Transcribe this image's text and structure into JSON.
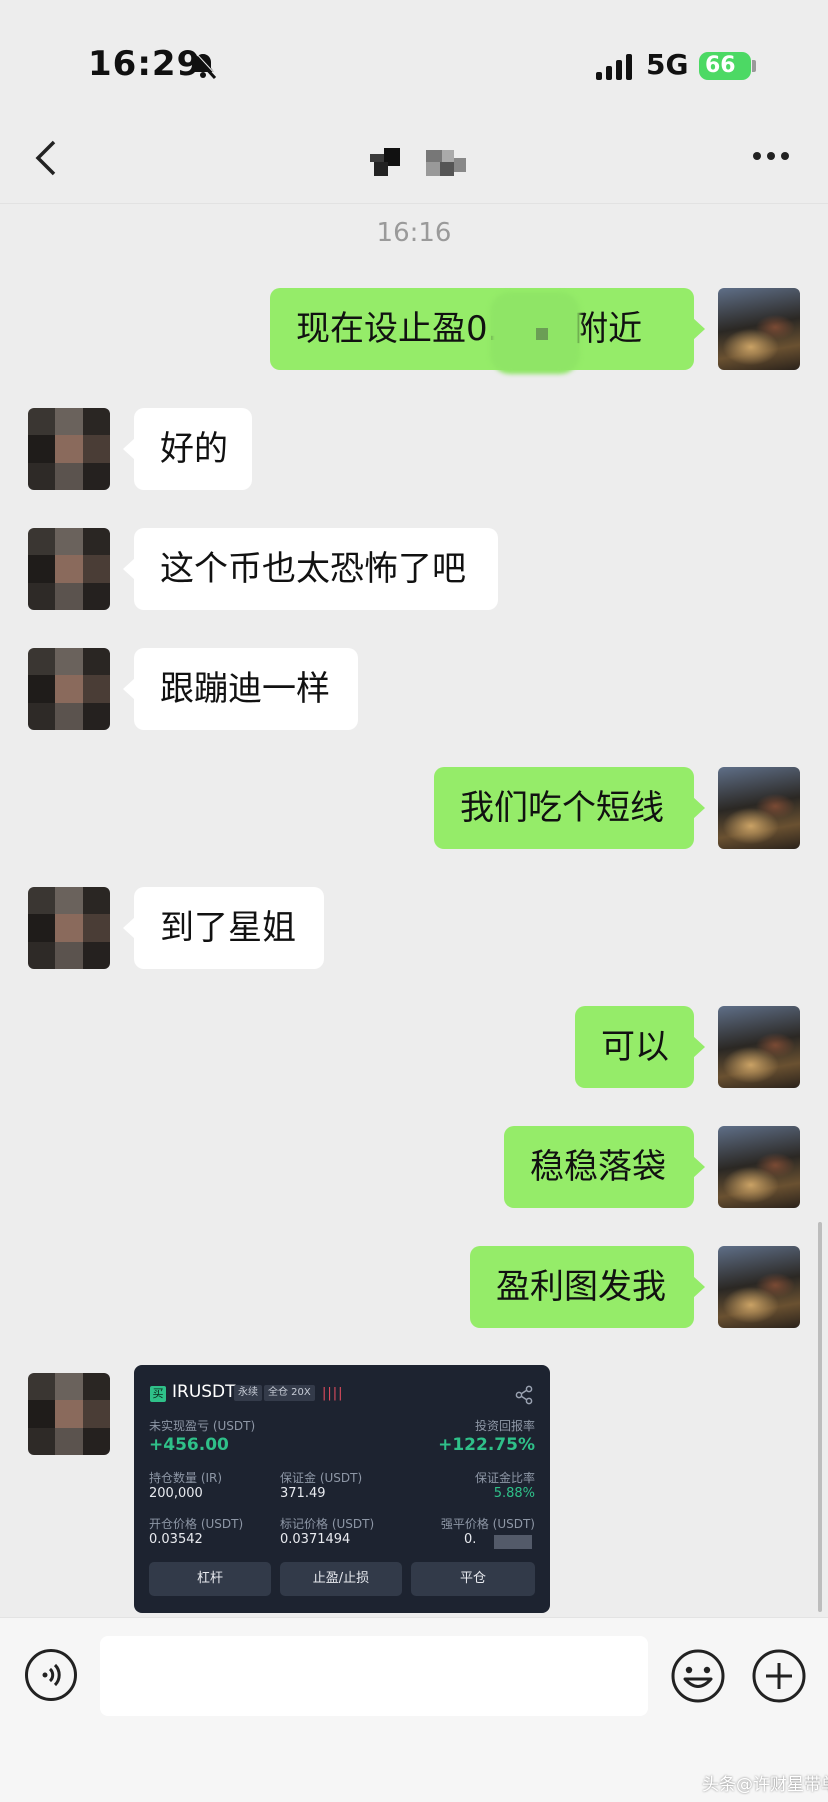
{
  "status_bar": {
    "time": "16:29",
    "network": "5G",
    "battery": "66"
  },
  "header": {
    "title": ""
  },
  "chat": {
    "timestamp": "16:16",
    "messages": [
      {
        "sender": "me",
        "text": "现在设止盈0.     4附近"
      },
      {
        "sender": "them",
        "text": "好的"
      },
      {
        "sender": "them",
        "text": "这个币也太恐怖了吧"
      },
      {
        "sender": "them",
        "text": "跟蹦迪一样"
      },
      {
        "sender": "me",
        "text": "我们吃个短线"
      },
      {
        "sender": "them",
        "text": "到了星姐"
      },
      {
        "sender": "me",
        "text": "可以"
      },
      {
        "sender": "me",
        "text": "稳稳落袋"
      },
      {
        "sender": "me",
        "text": "盈利图发我"
      }
    ]
  },
  "trade_card": {
    "side": "买",
    "symbol": "IRUSDT",
    "tag_perpetual": "永续",
    "tag_margin": "全仓 20X",
    "pnl_label": "未实现盈亏 (USDT)",
    "pnl_value": "+456.00",
    "roi_label": "投资回报率",
    "roi_value": "+122.75%",
    "size_label": "持仓数量 (IR)",
    "size_value": "200,000",
    "margin_label": "保证金 (USDT)",
    "margin_value": "371.49",
    "margin_ratio_label": "保证金比率",
    "margin_ratio_value": "5.88%",
    "entry_label": "开仓价格 (USDT)",
    "entry_value": "0.03542",
    "mark_label": "标记价格 (USDT)",
    "mark_value": "0.0371494",
    "liq_label": "强平价格 (USDT)",
    "liq_value": "0.",
    "btn_leverage": "杠杆",
    "btn_tpsl": "止盈/止损",
    "btn_close": "平仓"
  },
  "input_bar": {
    "placeholder": ""
  },
  "watermark": "头条@许财星带单",
  "colors": {
    "my_bubble": "#95ec69",
    "their_bubble": "#ffffff",
    "background": "#ededed",
    "profit_green": "#2fc089"
  }
}
